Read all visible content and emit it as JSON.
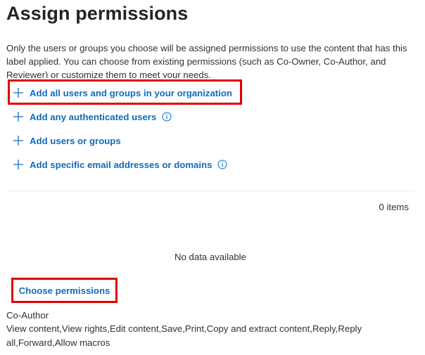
{
  "page": {
    "title": "Assign permissions",
    "description": "Only the users or groups you choose will be assigned permissions to use the content that has this label applied. You can choose from existing permissions (such as Co-Owner, Co-Author, and Reviewer) or customize them to meet your needs."
  },
  "actions": [
    {
      "label": "Add all users and groups in your organization",
      "icon": "plus-icon",
      "info": false
    },
    {
      "label": "Add any authenticated users",
      "icon": "plus-icon",
      "info": true,
      "info_icon": "info-icon"
    },
    {
      "label": "Add users or groups",
      "icon": "plus-icon",
      "info": false
    },
    {
      "label": "Add specific email addresses or domains",
      "icon": "plus-icon",
      "info": true,
      "info_icon": "info-icon"
    }
  ],
  "list": {
    "count": "0 items",
    "empty_message": "No data available"
  },
  "permissions": {
    "choose_label": "Choose permissions",
    "role": "Co-Author",
    "rights": "View content,View rights,Edit content,Save,Print,Copy and extract content,Reply,Reply all,Forward,Allow macros"
  },
  "colors": {
    "accent": "#0f6cbd",
    "highlight": "#e00000",
    "text": "#323130",
    "title": "#252423",
    "divider": "#edebe9"
  }
}
